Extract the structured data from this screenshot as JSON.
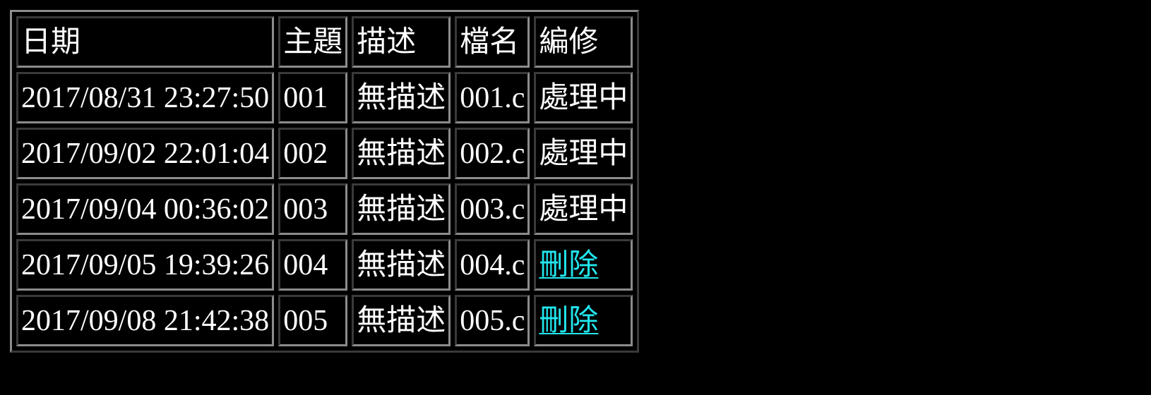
{
  "table": {
    "headers": {
      "date": "日期",
      "subject": "主題",
      "description": "描述",
      "filename": "檔名",
      "edit": "編修"
    },
    "rows": [
      {
        "date": "2017/08/31 23:27:50",
        "subject": "001",
        "description": "無描述",
        "filename": "001.c",
        "status": "處理中"
      },
      {
        "date": "2017/09/02 22:01:04",
        "subject": "002",
        "description": "無描述",
        "filename": "002.c",
        "status": "處理中"
      },
      {
        "date": "2017/09/04 00:36:02",
        "subject": "003",
        "description": "無描述",
        "filename": "003.c",
        "status": "處理中"
      },
      {
        "date": "2017/09/05 19:39:26",
        "subject": "004",
        "description": "無描述",
        "filename": "004.c",
        "delete_label": "刪除"
      },
      {
        "date": "2017/09/08 21:42:38",
        "subject": "005",
        "description": "無描述",
        "filename": "005.c",
        "delete_label": "刪除"
      }
    ]
  },
  "colors": {
    "background": "#000000",
    "text": "#ffffff",
    "link": "#22e6ee"
  }
}
